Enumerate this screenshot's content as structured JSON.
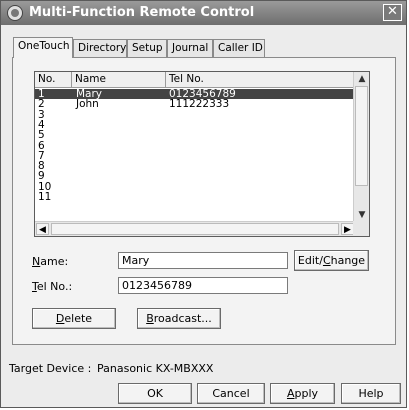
{
  "window": {
    "title": "Multi-Function Remote Control",
    "close_glyph": "✕"
  },
  "tabs": [
    {
      "label": "OneTouch",
      "active": true
    },
    {
      "label": "Directory",
      "active": false
    },
    {
      "label": "Setup",
      "active": false
    },
    {
      "label": "Journal",
      "active": false
    },
    {
      "label": "Caller ID",
      "active": false
    }
  ],
  "list": {
    "columns": [
      "No.",
      "Name",
      "Tel No."
    ],
    "rows": [
      {
        "no": "1",
        "name": "Mary",
        "tel": "0123456789",
        "selected": true
      },
      {
        "no": "2",
        "name": "John",
        "tel": "111222333",
        "selected": false
      },
      {
        "no": "3",
        "name": "",
        "tel": "",
        "selected": false
      },
      {
        "no": "4",
        "name": "",
        "tel": "",
        "selected": false
      },
      {
        "no": "5",
        "name": "",
        "tel": "",
        "selected": false
      },
      {
        "no": "6",
        "name": "",
        "tel": "",
        "selected": false
      },
      {
        "no": "7",
        "name": "",
        "tel": "",
        "selected": false
      },
      {
        "no": "8",
        "name": "",
        "tel": "",
        "selected": false
      },
      {
        "no": "9",
        "name": "",
        "tel": "",
        "selected": false
      },
      {
        "no": "10",
        "name": "",
        "tel": "",
        "selected": false
      },
      {
        "no": "11",
        "name": "",
        "tel": "",
        "selected": false
      }
    ]
  },
  "form": {
    "name_label_key": "N",
    "name_label_rest": "ame:",
    "name_value": "Mary",
    "tel_label_key": "T",
    "tel_label_rest": "el No.:",
    "tel_value": "0123456789",
    "edit_button_prefix": "Edit/",
    "edit_button_key": "C",
    "edit_button_rest": "hange",
    "delete_button_key": "D",
    "delete_button_rest": "elete",
    "broadcast_button_key": "B",
    "broadcast_button_rest": "roadcast..."
  },
  "footer": {
    "target_label": "Target Device :",
    "target_value": "Panasonic KX-MBXXX",
    "ok_label": "OK",
    "cancel_label": "Cancel",
    "apply_key": "A",
    "apply_rest": "pply",
    "help_label": "Help"
  },
  "colors": {
    "selected_row_bg": "#444444",
    "titlebar": "#7e7e7e"
  }
}
